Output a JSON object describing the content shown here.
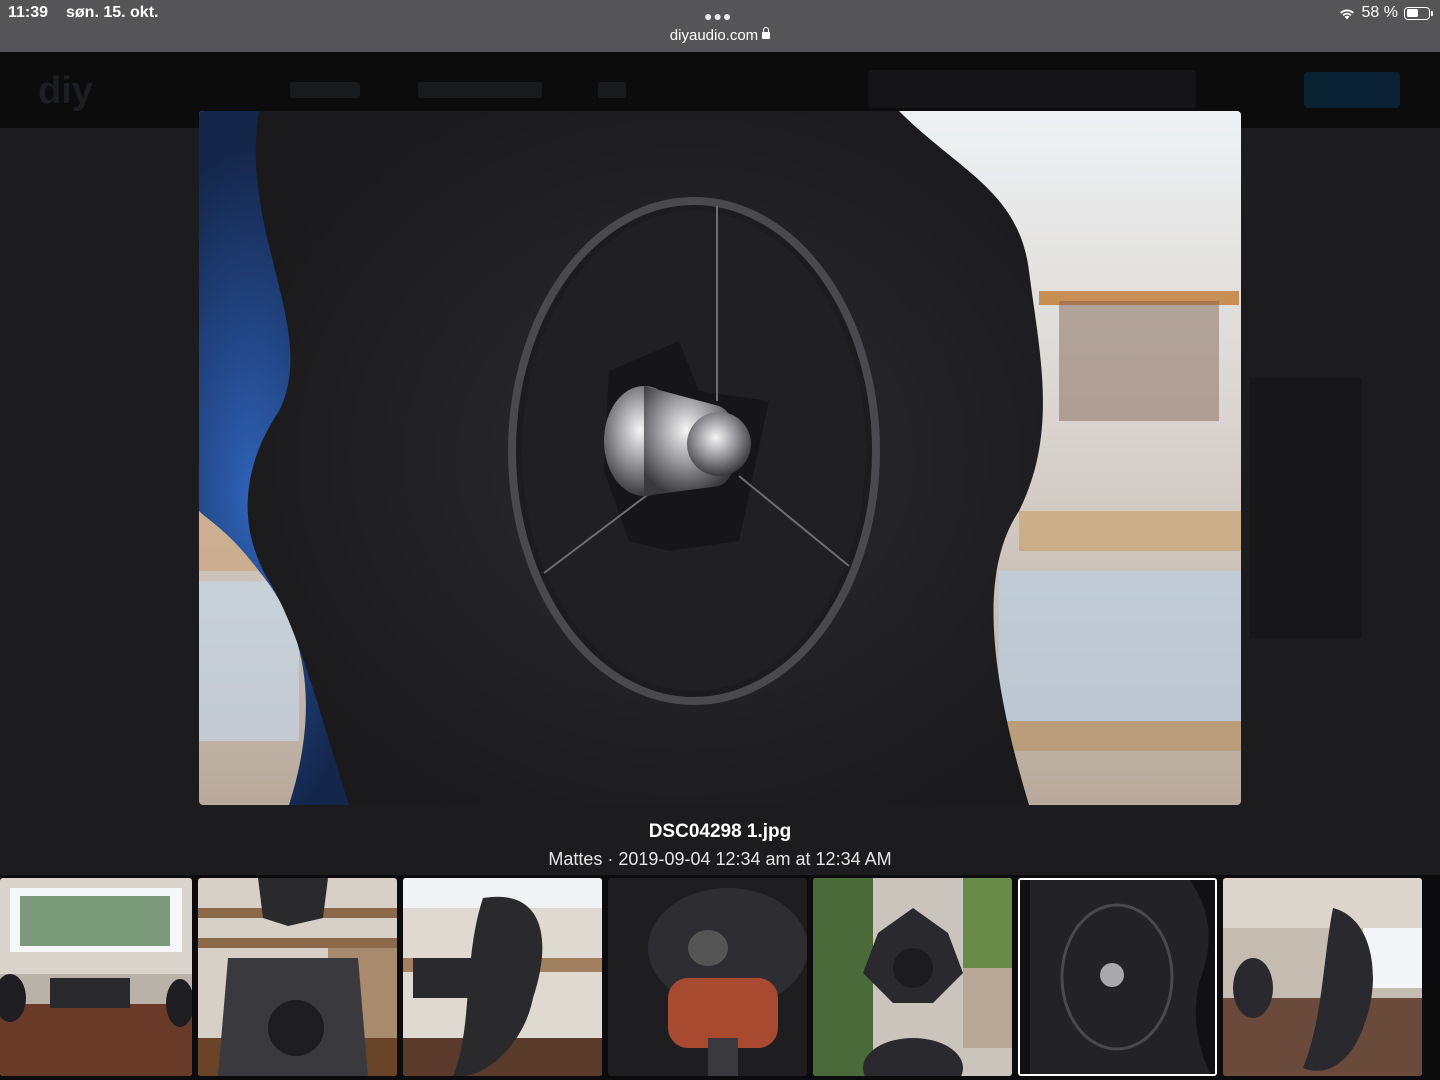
{
  "status_bar": {
    "time": "11:39",
    "date": "søn. 15. okt.",
    "url": "diyaudio.com",
    "battery": "58 %",
    "battery_level": 0.58,
    "icons": [
      "wifi-icon",
      "battery-icon",
      "lock-icon",
      "more-dots-icon"
    ]
  },
  "lightbox": {
    "title": "DSC04298 1.jpg",
    "meta": "Mattes · 2019-09-04 12:34 am at 12:34 AM",
    "thumbnails": [
      {
        "name": "thumb-1",
        "active": false
      },
      {
        "name": "thumb-2",
        "active": false
      },
      {
        "name": "thumb-3",
        "active": false
      },
      {
        "name": "thumb-4",
        "active": false
      },
      {
        "name": "thumb-5",
        "active": false
      },
      {
        "name": "thumb-6",
        "active": true
      },
      {
        "name": "thumb-7",
        "active": false
      }
    ]
  },
  "colors": {
    "status_bar_bg": "#555557",
    "page_bg": "#1a1a1c",
    "active_thumb_border": "#ffffff"
  }
}
